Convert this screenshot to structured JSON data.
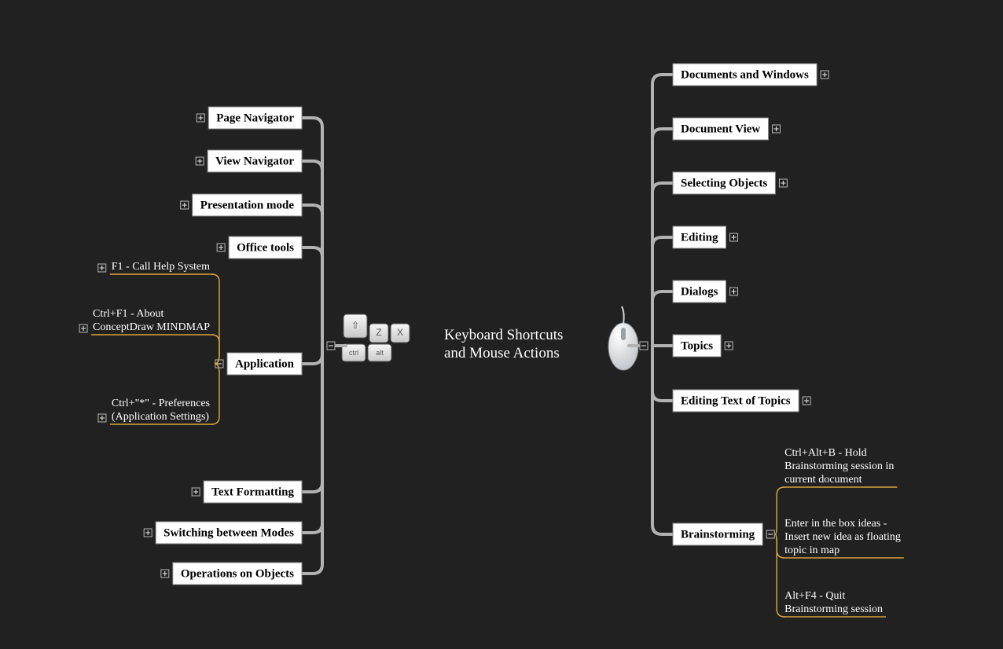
{
  "center": {
    "title_line1": "Keyboard Shortcuts",
    "title_line2": "and Mouse Actions"
  },
  "left": [
    {
      "id": "page-navigator",
      "label": "Page Navigator"
    },
    {
      "id": "view-navigator",
      "label": "View Navigator"
    },
    {
      "id": "presentation-mode",
      "label": "Presentation mode"
    },
    {
      "id": "office-tools",
      "label": "Office tools"
    },
    {
      "id": "application",
      "label": "Application",
      "expanded": true,
      "children": [
        "F1 - Call Help System",
        "Ctrl+F1 - About ConceptDraw MINDMAP",
        "Ctrl+\"*\" - Preferences (Application Settings)"
      ]
    },
    {
      "id": "text-formatting",
      "label": "Text Formatting"
    },
    {
      "id": "switching-modes",
      "label": "Switching between Modes"
    },
    {
      "id": "operations-objects",
      "label": "Operations on Objects"
    }
  ],
  "right": [
    {
      "id": "documents-windows",
      "label": "Documents and Windows"
    },
    {
      "id": "document-view",
      "label": "Document View"
    },
    {
      "id": "selecting-objects",
      "label": "Selecting Objects"
    },
    {
      "id": "editing",
      "label": "Editing"
    },
    {
      "id": "dialogs",
      "label": "Dialogs"
    },
    {
      "id": "topics",
      "label": "Topics"
    },
    {
      "id": "editing-text-topics",
      "label": "Editing Text of Topics"
    },
    {
      "id": "brainstorming",
      "label": "Brainstorming",
      "expanded": true,
      "children": [
        "Ctrl+Alt+B - Hold Brainstorming session in current document",
        "Enter in the box ideas - Insert new idea as floating topic in map",
        "Alt+F4 - Quit Brainstorming session"
      ]
    }
  ]
}
